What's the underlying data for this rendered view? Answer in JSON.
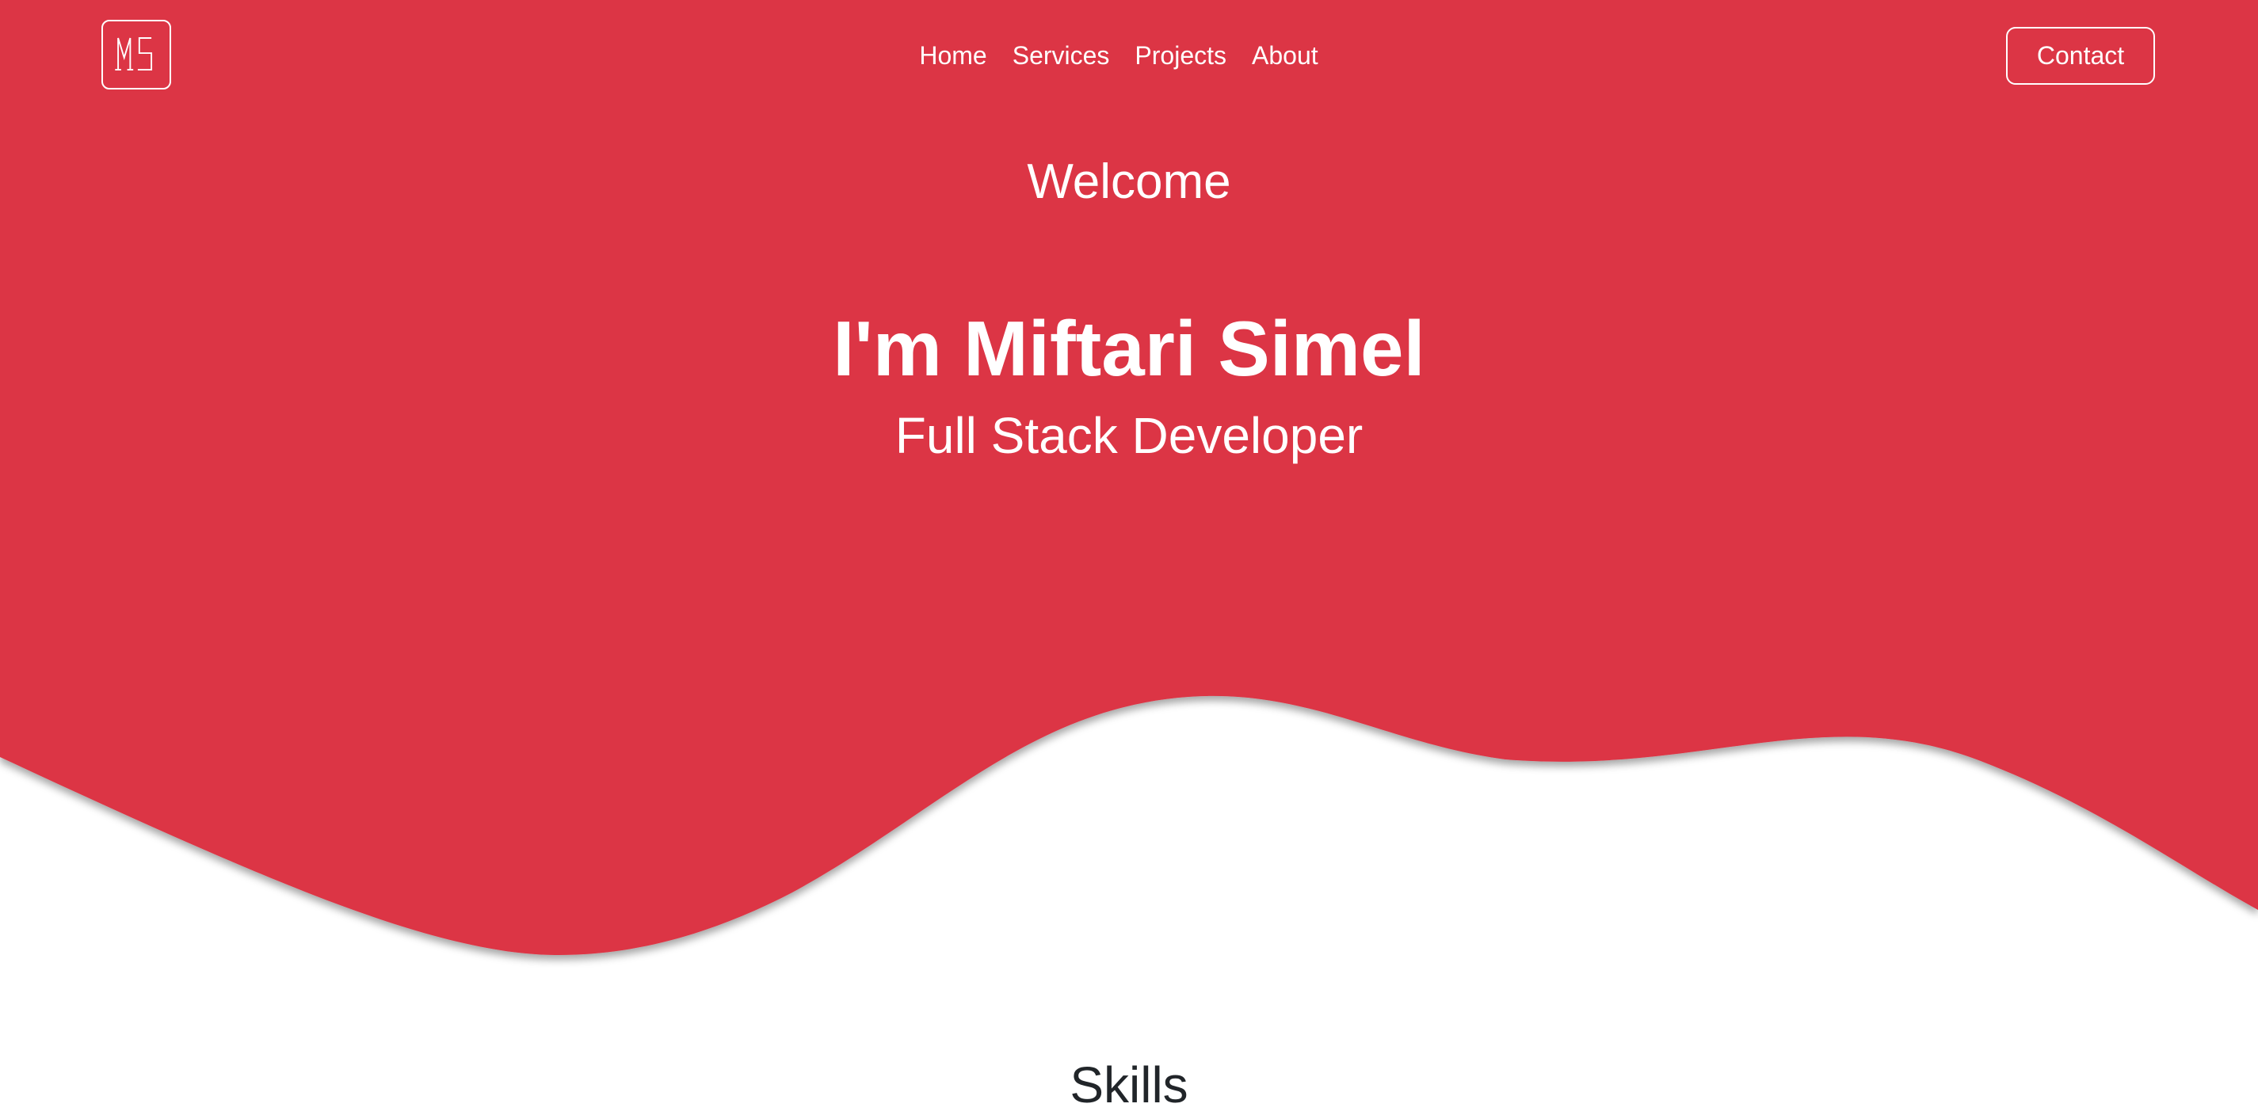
{
  "brand": {
    "logo_text": "MS"
  },
  "nav": {
    "items": [
      {
        "label": "Home"
      },
      {
        "label": "Services"
      },
      {
        "label": "Projects"
      },
      {
        "label": "About"
      }
    ],
    "contact_label": "Contact"
  },
  "hero": {
    "welcome": "Welcome",
    "name": "I'm Miftari Simel",
    "role": "Full Stack Developer"
  },
  "skills": {
    "title": "Skills"
  },
  "colors": {
    "primary": "#dc3545",
    "text_dark": "#212529",
    "text_light": "#ffffff"
  }
}
